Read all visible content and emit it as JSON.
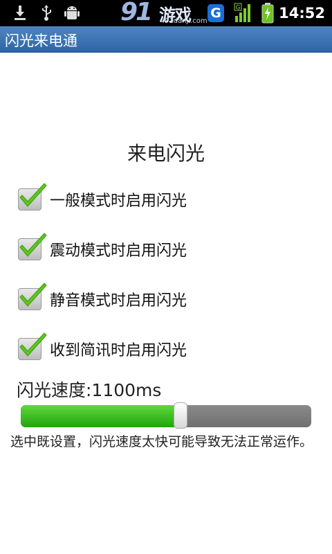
{
  "status_bar": {
    "time": "14:52",
    "badge_letter": "G",
    "signal_label": "G",
    "watermark_number": "91",
    "watermark_brand": "游戏",
    "watermark_url": "91danji.com",
    "icons": [
      "download-icon",
      "usb-icon",
      "android-icon",
      "g-badge-icon",
      "signal-icon",
      "battery-charging-icon"
    ]
  },
  "app": {
    "title": "闪光来电通"
  },
  "main": {
    "heading": "来电闪光",
    "options": [
      {
        "label": "一般模式时启用闪光",
        "checked": true
      },
      {
        "label": "震动模式时启用闪光",
        "checked": true
      },
      {
        "label": "静音模式时启用闪光",
        "checked": true
      },
      {
        "label": "收到简讯时启用闪光",
        "checked": true
      }
    ],
    "speed_label": "闪光速度:1100ms",
    "speed_fraction": 0.55,
    "note": "选中既设置，闪光速度太快可能导致无法正常运作。"
  },
  "colors": {
    "title_bar": "#3a71b2",
    "slider_fill": "#2fb51a",
    "slider_track": "#7a7a7a",
    "check": "#5cc61f"
  }
}
